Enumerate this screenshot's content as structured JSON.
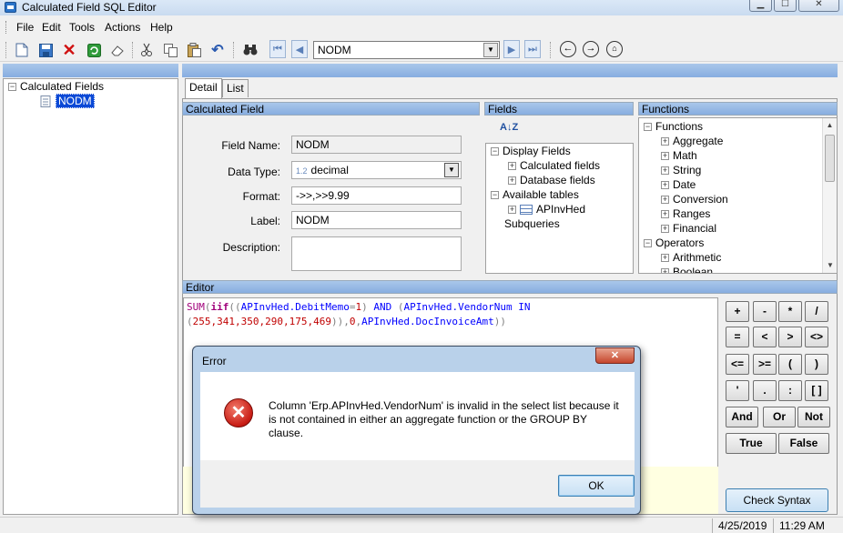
{
  "window": {
    "title": "Calculated Field SQL Editor",
    "minimize": "▁",
    "maximize": "☐",
    "close": "✕"
  },
  "menu": [
    "File",
    "Edit",
    "Tools",
    "Actions",
    "Help"
  ],
  "toolbar": {
    "record_value": "NODM",
    "first": "⏮",
    "prev": "◀",
    "next": "▶",
    "last": "⏭"
  },
  "left_tree": {
    "root": "Calculated Fields",
    "child": "NODM"
  },
  "tabs": [
    "Detail",
    "List"
  ],
  "calc_field": {
    "header": "Calculated Field",
    "field_name_label": "Field Name:",
    "field_name": "NODM",
    "data_type_label": "Data Type:",
    "data_type_prefix": "1.2",
    "data_type": "decimal",
    "format_label": "Format:",
    "format": "->>,>>9.99",
    "label_label": "Label:",
    "label": "NODM",
    "description_label": "Description:",
    "description": ""
  },
  "fields_panel": {
    "header": "Fields",
    "sort": "A↓Z",
    "items": [
      "Display Fields",
      "Calculated fields",
      "Database fields",
      "Available tables",
      "APInvHed",
      "Subqueries"
    ]
  },
  "functions_panel": {
    "header": "Functions",
    "items": [
      "Functions",
      "Aggregate",
      "Math",
      "String",
      "Date",
      "Conversion",
      "Ranges",
      "Financial",
      "Operators",
      "Arithmetic",
      "Boolean"
    ]
  },
  "editor": {
    "header": "Editor",
    "line1": [
      "SUM",
      "(",
      "iif",
      "((",
      "APInvHed.DebitMemo",
      "=",
      "1",
      ")",
      " AND ",
      "(",
      "APInvHed.VendorNum",
      " IN"
    ],
    "line2": [
      "(",
      "255,341,350,290,175,469",
      "))",
      ",",
      "0",
      ",",
      "APInvHed.DocInvoiceAmt",
      "))"
    ]
  },
  "operators": {
    "row1": [
      "+",
      "-",
      "*",
      "/"
    ],
    "row2": [
      "=",
      "<",
      ">",
      "<>"
    ],
    "row3": [
      "<=",
      ">=",
      "(",
      ")"
    ],
    "row4": [
      "'",
      ".",
      ":",
      "[ ]"
    ],
    "row5": [
      "And",
      "Or",
      "Not"
    ],
    "row6": [
      "True",
      "False"
    ]
  },
  "check_syntax": "Check Syntax",
  "status": {
    "date": "4/25/2019",
    "time": "11:29 AM"
  },
  "dialog": {
    "title": "Error",
    "close": "✕",
    "message": "Column 'Erp.APInvHed.VendorNum' is invalid in the select list because it is not contained in either an aggregate function or the GROUP BY clause.",
    "ok": "OK"
  },
  "colors": {
    "header_blue": "#87ade0",
    "selection": "#0a49d6",
    "error_red": "#c81c14"
  }
}
